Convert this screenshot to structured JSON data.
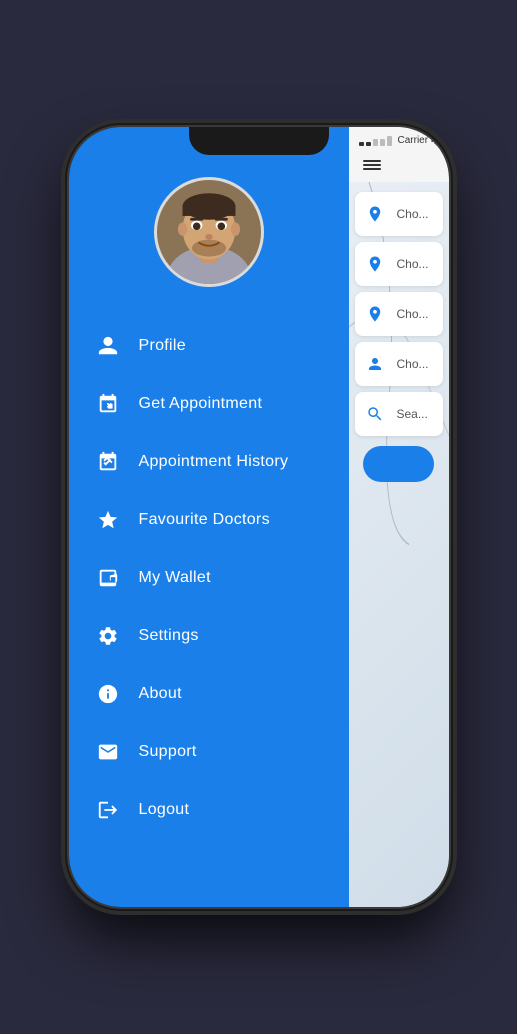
{
  "phone": {
    "notch": true
  },
  "statusBar": {
    "carrier": "Carrier",
    "wifi_icon": "wifi",
    "signal": "●●○○○"
  },
  "sidebar": {
    "menu_items": [
      {
        "id": "profile",
        "label": "Profile",
        "icon": "person"
      },
      {
        "id": "get-appointment",
        "label": "Get Appointment",
        "icon": "calendar-plus"
      },
      {
        "id": "appointment-history",
        "label": "Appointment History",
        "icon": "calendar-check"
      },
      {
        "id": "favourite-doctors",
        "label": "Favourite Doctors",
        "icon": "star"
      },
      {
        "id": "my-wallet",
        "label": "My Wallet",
        "icon": "wallet"
      },
      {
        "id": "settings",
        "label": "Settings",
        "icon": "gear"
      },
      {
        "id": "about",
        "label": "About",
        "icon": "info"
      },
      {
        "id": "support",
        "label": "Support",
        "icon": "envelope"
      },
      {
        "id": "logout",
        "label": "Logout",
        "icon": "logout"
      }
    ]
  },
  "mainContent": {
    "rows": [
      {
        "icon": "person-location",
        "text": "Cho..."
      },
      {
        "icon": "location",
        "text": "Cho..."
      },
      {
        "icon": "location",
        "text": "Cho..."
      },
      {
        "icon": "person-medical",
        "text": "Cho..."
      },
      {
        "icon": "search-person",
        "text": "Sea..."
      }
    ]
  },
  "colors": {
    "blue": "#1a7fe8",
    "white": "#ffffff",
    "light_gray": "#f5f5f5",
    "dark": "#1a1a1a"
  }
}
